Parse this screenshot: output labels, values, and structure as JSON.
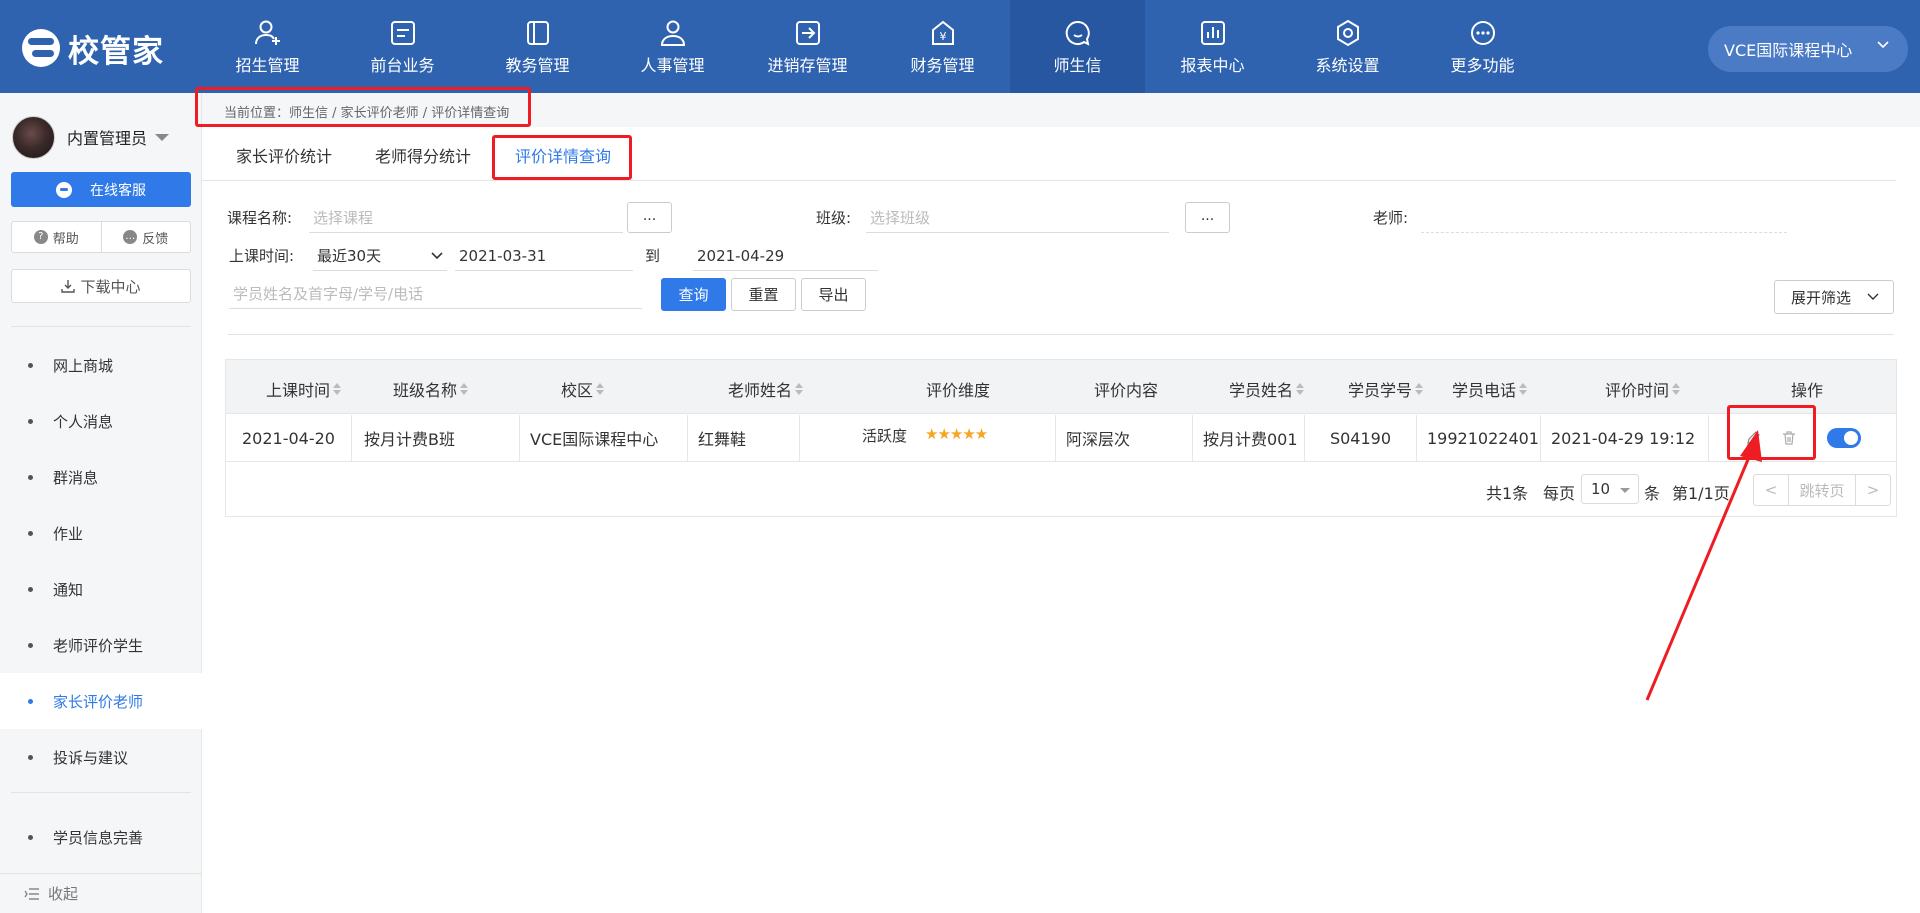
{
  "header": {
    "logo_text": "校管家",
    "nav": [
      {
        "label": "招生管理",
        "icon": "user-plus-icon"
      },
      {
        "label": "前台业务",
        "icon": "message-box-icon"
      },
      {
        "label": "教务管理",
        "icon": "book-icon"
      },
      {
        "label": "人事管理",
        "icon": "person-icon"
      },
      {
        "label": "进销存管理",
        "icon": "box-arrow-icon"
      },
      {
        "label": "财务管理",
        "icon": "yen-house-icon"
      },
      {
        "label": "师生信",
        "icon": "chat-bubble-icon",
        "active": true
      },
      {
        "label": "报表中心",
        "icon": "bar-chart-icon"
      },
      {
        "label": "系统设置",
        "icon": "hexagon-gear-icon"
      },
      {
        "label": "更多功能",
        "icon": "more-dots-icon"
      }
    ],
    "campus": "VCE国际课程中心"
  },
  "sidebar": {
    "user_name": "内置管理员",
    "service_label": "在线客服",
    "help_label": "帮助",
    "feedback_label": "反馈",
    "download_label": "下载中心",
    "items": [
      {
        "label": "网上商城"
      },
      {
        "label": "个人消息"
      },
      {
        "label": "群消息"
      },
      {
        "label": "作业"
      },
      {
        "label": "通知"
      },
      {
        "label": "老师评价学生"
      },
      {
        "label": "家长评价老师",
        "active": true
      },
      {
        "label": "投诉与建议"
      },
      {
        "label": "学员信息完善"
      }
    ],
    "collapse_label": "收起"
  },
  "breadcrumb": "当前位置：师生信 / 家长评价老师 / 评价详情查询",
  "tabs": [
    "家长评价统计",
    "老师得分统计",
    "评价详情查询"
  ],
  "active_tab": 2,
  "filters": {
    "course_label": "课程名称:",
    "course_placeholder": "选择课程",
    "dots": "...",
    "class_label": "班级:",
    "class_placeholder": "选择班级",
    "teacher_label": "老师:",
    "time_label": "上课时间:",
    "time_range": "最近30天",
    "date_from": "2021-03-31",
    "to_label": "到",
    "date_to": "2021-04-29",
    "search_placeholder": "学员姓名及首字母/学号/电话",
    "query_btn": "查询",
    "reset_btn": "重置",
    "export_btn": "导出",
    "expand_btn": "展开筛选"
  },
  "table": {
    "columns": [
      "上课时间",
      "班级名称",
      "校区",
      "老师姓名",
      "评价维度",
      "评价内容",
      "学员姓名",
      "学员学号",
      "学员电话",
      "评价时间",
      "操作"
    ],
    "rows": [
      {
        "class_time": "2021-04-20",
        "class_name": "按月计费B班",
        "campus": "VCE国际课程中心",
        "teacher": "红舞鞋",
        "dimension": "活跃度",
        "stars": "★★★★★",
        "rating": 5,
        "content": "阿深层次",
        "student_name": "按月计费001",
        "student_no": "S04190",
        "phone": "19921022401",
        "eval_time": "2021-04-29 19:12",
        "enabled": true
      }
    ]
  },
  "pager": {
    "total": "共1条",
    "per_page_label": "每页",
    "page_size": "10",
    "unit": "条",
    "page_info": "第1/1页",
    "prev": "<",
    "jump": "跳转页",
    "next": ">"
  },
  "colors": {
    "header_bg": "#2f63b0",
    "accent": "#2f7ae8",
    "annotation_red": "#ee1d23",
    "star": "#f5a623"
  }
}
